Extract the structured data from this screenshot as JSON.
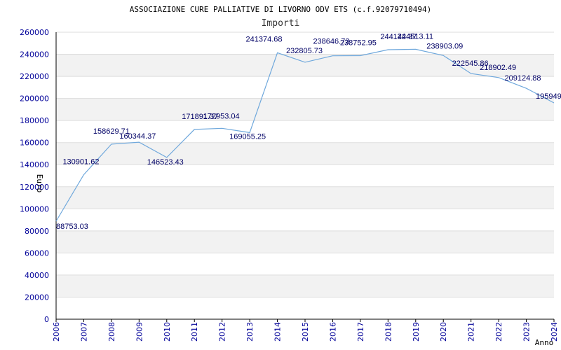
{
  "chart_data": {
    "type": "line",
    "title": "ASSOCIAZIONE CURE PALLIATIVE DI LIVORNO ODV ETS (c.f.92079710494)",
    "subtitle": "Importi",
    "xlabel": "Anno",
    "ylabel": "Euro",
    "ylim": [
      0,
      260000
    ],
    "xlim": [
      2006,
      2024
    ],
    "y_ticks": [
      0,
      20000,
      40000,
      60000,
      80000,
      100000,
      120000,
      140000,
      160000,
      180000,
      200000,
      220000,
      240000,
      260000
    ],
    "x_ticks": [
      2006,
      2007,
      2008,
      2009,
      2010,
      2011,
      2012,
      2013,
      2014,
      2015,
      2016,
      2017,
      2018,
      2019,
      2020,
      2021,
      2022,
      2023,
      2024
    ],
    "grid": "horizontal-bands",
    "series": [
      {
        "color": "#6fa8dc",
        "points": [
          {
            "x": 2006,
            "y": 88753.03,
            "label": "88753.03"
          },
          {
            "x": 2007,
            "y": 130901.62,
            "label": "130901.62"
          },
          {
            "x": 2008,
            "y": 158629.71,
            "label": "158629.71"
          },
          {
            "x": 2009,
            "y": 160344.37,
            "label": "160344.37"
          },
          {
            "x": 2010,
            "y": 146523.43,
            "label": "146523.43"
          },
          {
            "x": 2011,
            "y": 171891.37,
            "label": "171891.37"
          },
          {
            "x": 2012,
            "y": 172953.04,
            "label": "172953.04"
          },
          {
            "x": 2013,
            "y": 169055.25,
            "label": "169055.25"
          },
          {
            "x": 2014,
            "y": 241374.68,
            "label": "241374.68"
          },
          {
            "x": 2015,
            "y": 232805.73,
            "label": "232805.73"
          },
          {
            "x": 2016,
            "y": 238646.73,
            "label": "238646.73"
          },
          {
            "x": 2017,
            "y": 238752.95,
            "label": "238752.95"
          },
          {
            "x": 2018,
            "y": 244142.37,
            "label": "244142.37"
          },
          {
            "x": 2019,
            "y": 244513.11,
            "label": "244513.11"
          },
          {
            "x": 2020,
            "y": 238903.09,
            "label": "238903.09"
          },
          {
            "x": 2021,
            "y": 222545.86,
            "label": "222545.86"
          },
          {
            "x": 2022,
            "y": 218902.49,
            "label": "218902.49"
          },
          {
            "x": 2023,
            "y": 209124.88,
            "label": "209124.88"
          },
          {
            "x": 2024,
            "y": 195949,
            "label": "195949"
          }
        ]
      }
    ],
    "colors": {
      "band": "#f2f2f2",
      "gridline": "#dddddd",
      "axis": "#000000",
      "tick_text": "#000099",
      "label_text": "#000066"
    }
  }
}
